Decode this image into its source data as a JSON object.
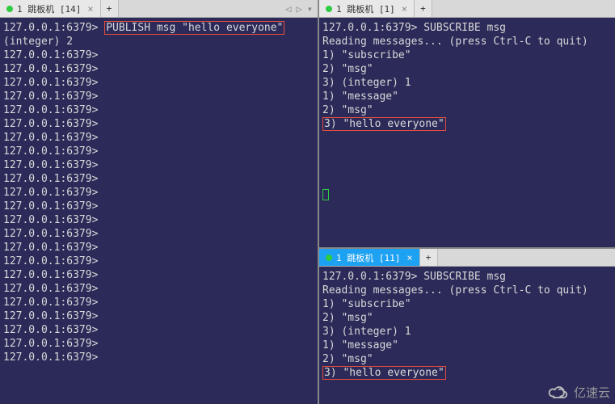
{
  "panes": {
    "left": {
      "tab_label": "1 跳板机 [14]",
      "prompt": "127.0.0.1:6379>",
      "command": "PUBLISH msg \"hello everyone\"",
      "response": "(integer) 2",
      "empty_prompt_count": 23
    },
    "right_top": {
      "tab_label": "1 跳板机 [1]",
      "prompt": "127.0.0.1:6379>",
      "command": "SUBSCRIBE msg",
      "lines": [
        "Reading messages... (press Ctrl-C to quit)",
        "1) \"subscribe\"",
        "2) \"msg\"",
        "3) (integer) 1",
        "1) \"message\"",
        "2) \"msg\""
      ],
      "highlight_line": "3) \"hello everyone\""
    },
    "right_bottom": {
      "tab_label": "1 跳板机 [11]",
      "prompt": "127.0.0.1:6379>",
      "command": "SUBSCRIBE msg",
      "lines": [
        "Reading messages... (press Ctrl-C to quit)",
        "1) \"subscribe\"",
        "2) \"msg\"",
        "3) (integer) 1",
        "1) \"message\"",
        "2) \"msg\""
      ],
      "highlight_line": "3) \"hello everyone\""
    }
  },
  "icons": {
    "add_tab": "+",
    "tab_close": "×",
    "nav_prev": "◁",
    "nav_next": "▷",
    "nav_menu": "▾"
  },
  "watermark": "亿速云"
}
